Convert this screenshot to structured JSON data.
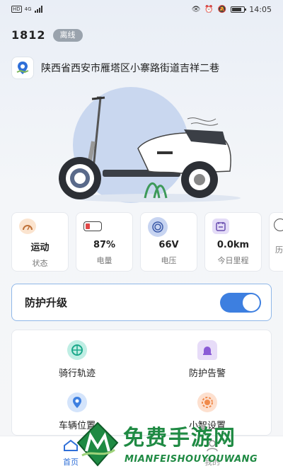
{
  "status_bar": {
    "network_badge": "HD",
    "network_type": "4G",
    "time": "14:05"
  },
  "device": {
    "id": "1812",
    "status": "离线"
  },
  "location": {
    "address": "陕西省西安市雁塔区小寨路街道吉祥二巷"
  },
  "stats": [
    {
      "icon": "speedometer-icon",
      "value": "运动",
      "label": "状态"
    },
    {
      "icon": "battery-icon",
      "value": "87%",
      "label": "电量",
      "level": 0.87
    },
    {
      "icon": "voltage-icon",
      "value": "66V",
      "label": "电压"
    },
    {
      "icon": "calendar-icon",
      "value": "0.0km",
      "label": "今日里程"
    },
    {
      "icon": "history-icon",
      "value": "",
      "label": "历"
    }
  ],
  "protection": {
    "label": "防护升级",
    "enabled": true
  },
  "features": [
    {
      "icon": "riding-track-icon",
      "label": "骑行轨迹"
    },
    {
      "icon": "alarm-icon",
      "label": "防护告警"
    },
    {
      "icon": "vehicle-location-icon",
      "label": "车辆位置"
    },
    {
      "icon": "smart-settings-icon",
      "label": "小智设置"
    }
  ],
  "tabbar": {
    "home": "首页",
    "mine": "我的"
  },
  "watermark": {
    "title": "免费手游网",
    "subtitle": "MIANFEISHOUYOUWANG"
  },
  "colors": {
    "accent": "#3d7fe0",
    "offline": "#9aa3ad",
    "watermark": "#1f8a43"
  }
}
